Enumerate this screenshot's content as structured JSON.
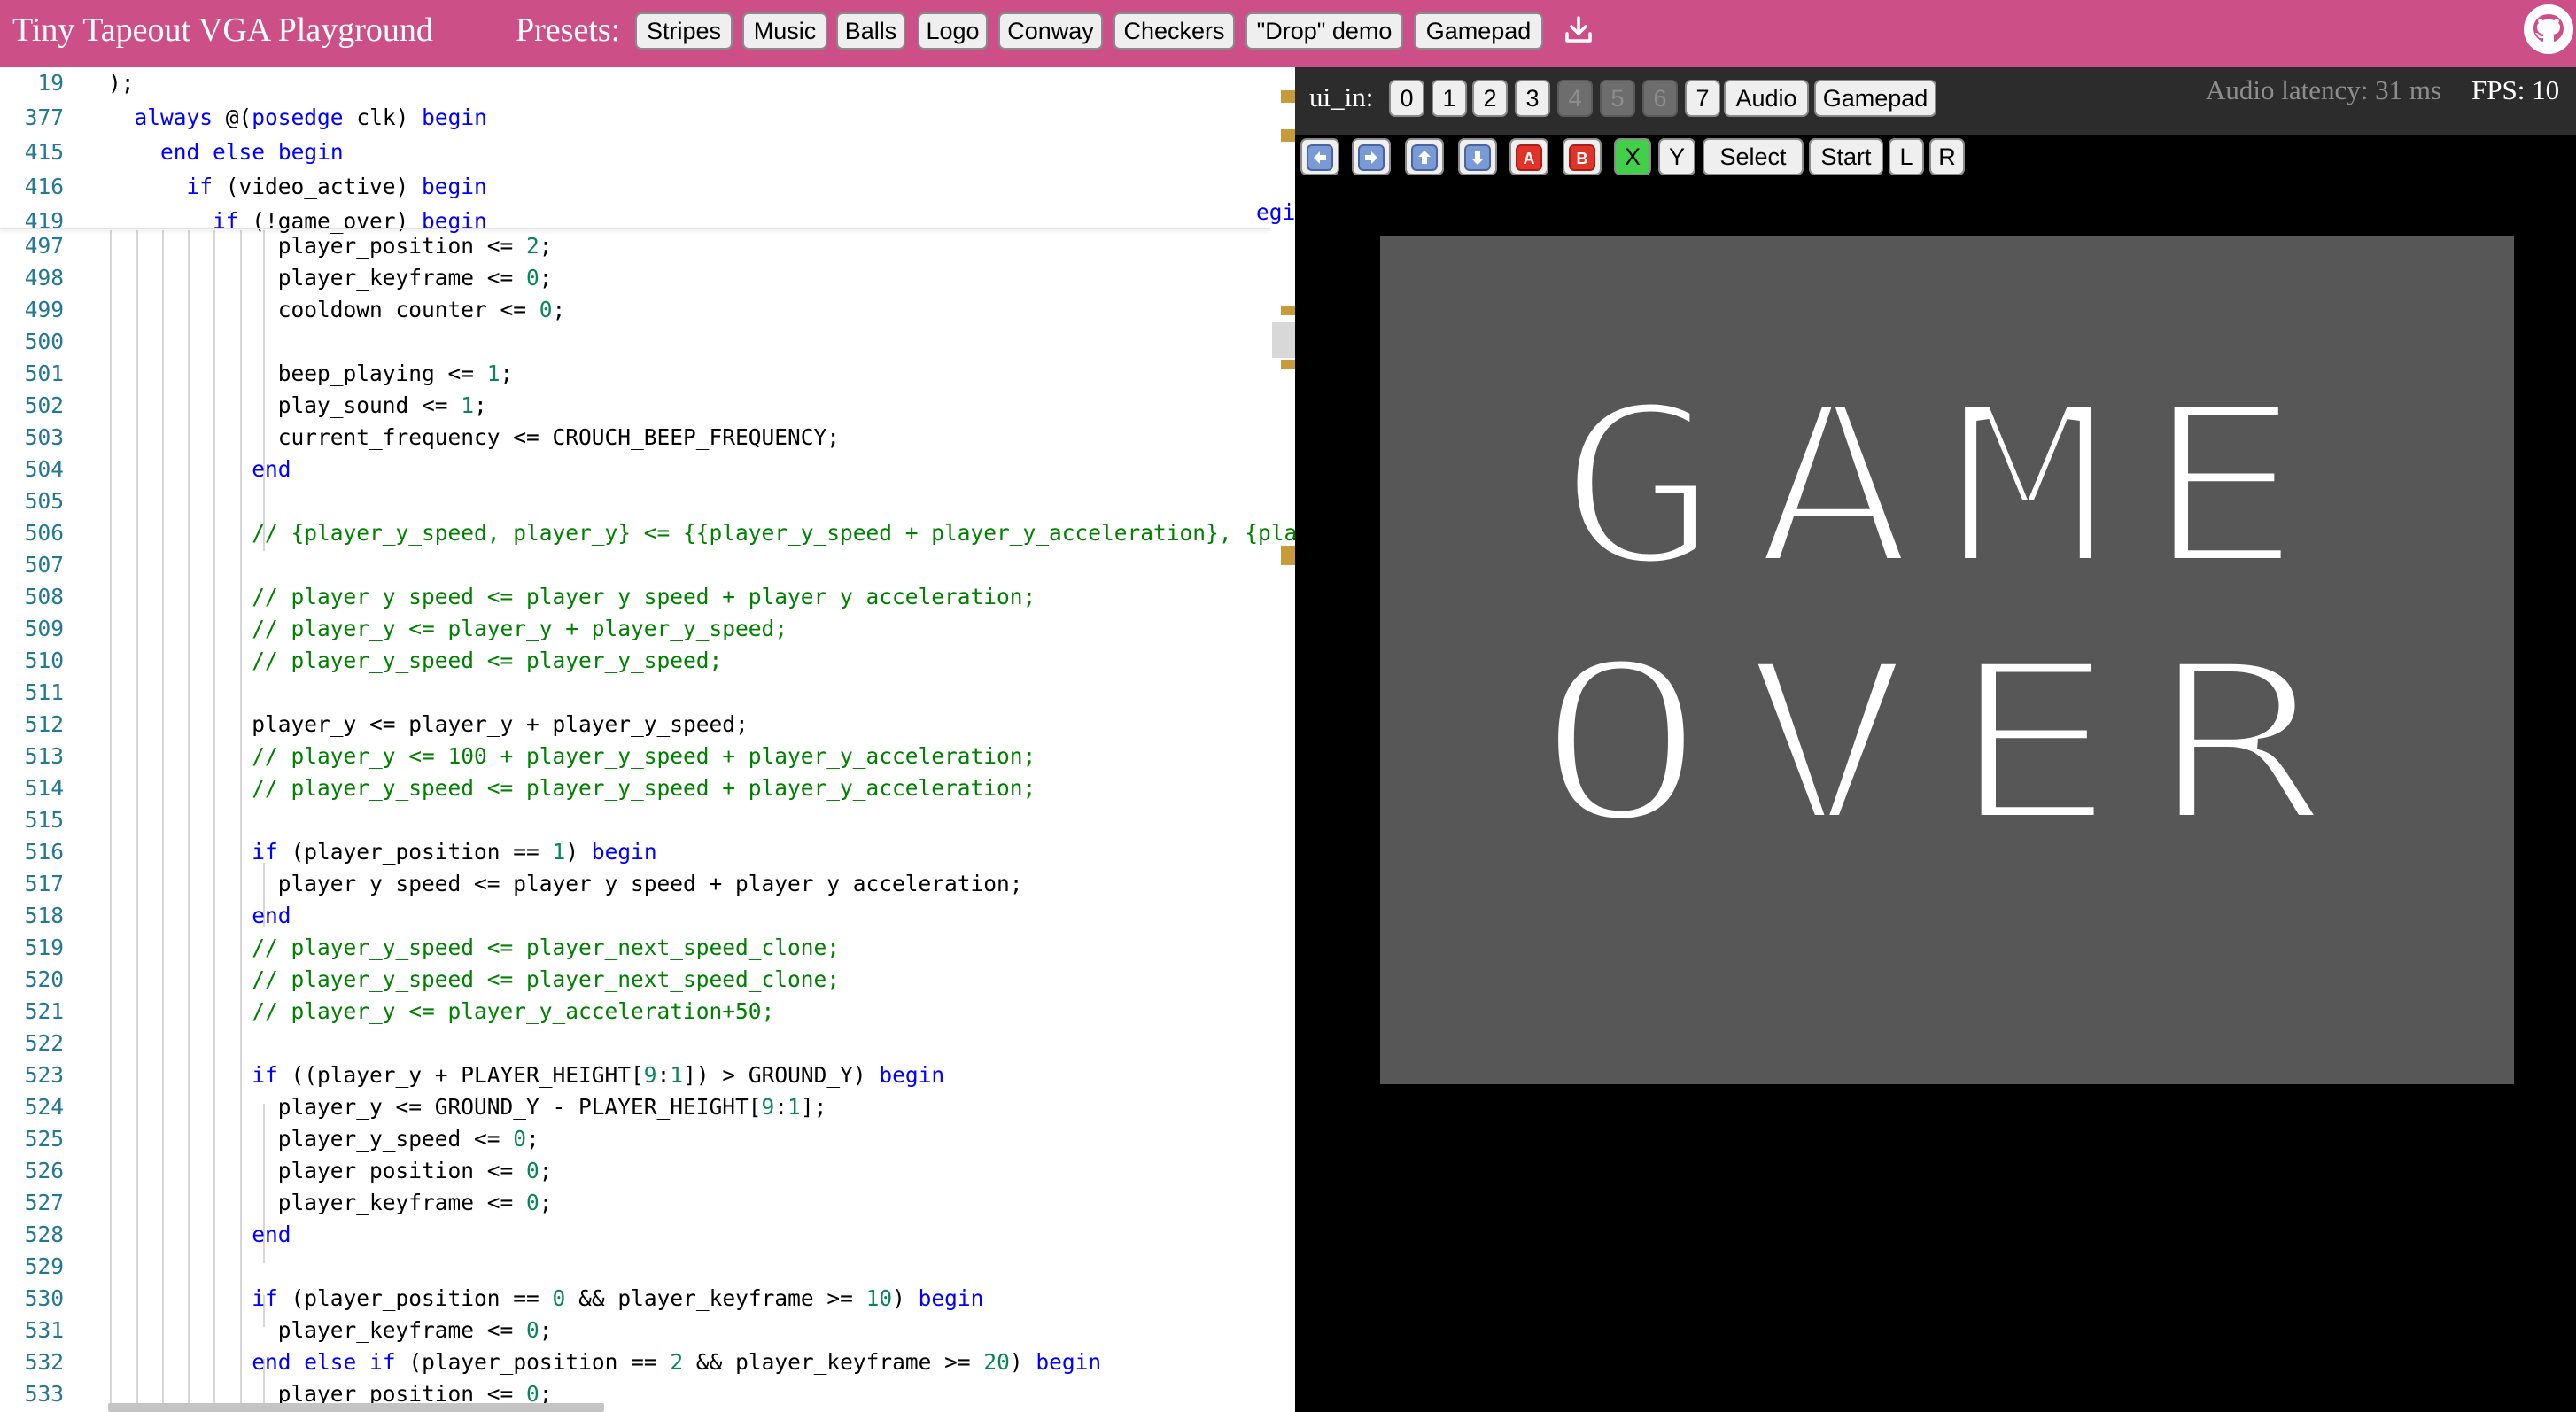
{
  "header": {
    "title": "Tiny Tapeout VGA Playground",
    "presets_label": "Presets:",
    "presets": [
      "Stripes",
      "Music",
      "Balls",
      "Logo",
      "Conway",
      "Checkers",
      "\"Drop\" demo",
      "Gamepad"
    ],
    "download_icon": "download-icon",
    "github_icon": "github-icon"
  },
  "editor": {
    "lines": [
      {
        "n": "19",
        "code": ");"
      },
      {
        "n": "377",
        "code": "  always @(posedge clk) begin"
      },
      {
        "n": "415",
        "code": "    end else begin"
      },
      {
        "n": "416",
        "code": "      if (video_active) begin"
      },
      {
        "n": "419",
        "code": "        if (!game_over) begin"
      },
      {
        "n": "497",
        "code": "             player_position <= 2;"
      },
      {
        "n": "498",
        "code": "             player_keyframe <= 0;"
      },
      {
        "n": "499",
        "code": "             cooldown_counter <= 0;"
      },
      {
        "n": "500",
        "code": ""
      },
      {
        "n": "501",
        "code": "             beep_playing <= 1;"
      },
      {
        "n": "502",
        "code": "             play_sound <= 1;"
      },
      {
        "n": "503",
        "code": "             current_frequency <= CROUCH_BEEP_FREQUENCY;"
      },
      {
        "n": "504",
        "code": "           end"
      },
      {
        "n": "505",
        "code": ""
      },
      {
        "n": "506",
        "code": "           // {player_y_speed, player_y} <= {{player_y_speed + player_y_acceleration}, {player"
      },
      {
        "n": "507",
        "code": ""
      },
      {
        "n": "508",
        "code": "           // player_y_speed <= player_y_speed + player_y_acceleration;"
      },
      {
        "n": "509",
        "code": "           // player_y <= player_y + player_y_speed;"
      },
      {
        "n": "510",
        "code": "           // player_y_speed <= player_y_speed;"
      },
      {
        "n": "511",
        "code": ""
      },
      {
        "n": "512",
        "code": "           player_y <= player_y + player_y_speed;"
      },
      {
        "n": "513",
        "code": "           // player_y <= 100 + player_y_speed + player_y_acceleration;"
      },
      {
        "n": "514",
        "code": "           // player_y_speed <= player_y_speed + player_y_acceleration;"
      },
      {
        "n": "515",
        "code": ""
      },
      {
        "n": "516",
        "code": "           if (player_position == 1) begin"
      },
      {
        "n": "517",
        "code": "             player_y_speed <= player_y_speed + player_y_acceleration;"
      },
      {
        "n": "518",
        "code": "           end"
      },
      {
        "n": "519",
        "code": "           // player_y_speed <= player_next_speed_clone;"
      },
      {
        "n": "520",
        "code": "           // player_y_speed <= player_next_speed_clone;"
      },
      {
        "n": "521",
        "code": "           // player_y <= player_y_acceleration+50;"
      },
      {
        "n": "522",
        "code": ""
      },
      {
        "n": "523",
        "code": "           if ((player_y + PLAYER_HEIGHT[9:1]) > GROUND_Y) begin"
      },
      {
        "n": "524",
        "code": "             player_y <= GROUND_Y - PLAYER_HEIGHT[9:1];"
      },
      {
        "n": "525",
        "code": "             player_y_speed <= 0;"
      },
      {
        "n": "526",
        "code": "             player_position <= 0;"
      },
      {
        "n": "527",
        "code": "             player_keyframe <= 0;"
      },
      {
        "n": "528",
        "code": "           end"
      },
      {
        "n": "529",
        "code": ""
      },
      {
        "n": "530",
        "code": "           if (player_position == 0 && player_keyframe >= 10) begin"
      },
      {
        "n": "531",
        "code": "             player_keyframe <= 0;"
      },
      {
        "n": "532",
        "code": "           end else if (player_position == 2 && player_keyframe >= 20) begin"
      },
      {
        "n": "533",
        "code": "             player_position <= 0;"
      }
    ],
    "sticky_overflow_text": "egi"
  },
  "controls": {
    "ui_in_label": "ui_in:",
    "bits": [
      {
        "label": "0",
        "enabled": true
      },
      {
        "label": "1",
        "enabled": true
      },
      {
        "label": "2",
        "enabled": true
      },
      {
        "label": "3",
        "enabled": true
      },
      {
        "label": "4",
        "enabled": false
      },
      {
        "label": "5",
        "enabled": false
      },
      {
        "label": "6",
        "enabled": false
      },
      {
        "label": "7",
        "enabled": true
      }
    ],
    "audio_label": "Audio",
    "gamepad_label": "Gamepad",
    "latency_text": "Audio latency: 31 ms",
    "fps_text": "FPS: 10",
    "gamepad_buttons": [
      {
        "icon": "left-arrow-icon"
      },
      {
        "icon": "right-arrow-icon"
      },
      {
        "icon": "up-arrow-icon"
      },
      {
        "icon": "down-arrow-icon"
      },
      {
        "icon": "a-button-icon",
        "glyph": "A"
      },
      {
        "icon": "b-button-icon",
        "glyph": "B"
      },
      {
        "label": "X",
        "active": true
      },
      {
        "label": "Y"
      },
      {
        "label": "Select"
      },
      {
        "label": "Start"
      },
      {
        "label": "L"
      },
      {
        "label": "R"
      }
    ]
  },
  "screen": {
    "line1": "GAME",
    "line2": "OVER",
    "background": "#575757",
    "text_color": "#ffffff"
  },
  "colors": {
    "header": "#cd4f88",
    "line_number": "#237893",
    "keyword": "#0000ff",
    "number": "#098658",
    "comment": "#008000",
    "active_button": "#42d04a"
  }
}
